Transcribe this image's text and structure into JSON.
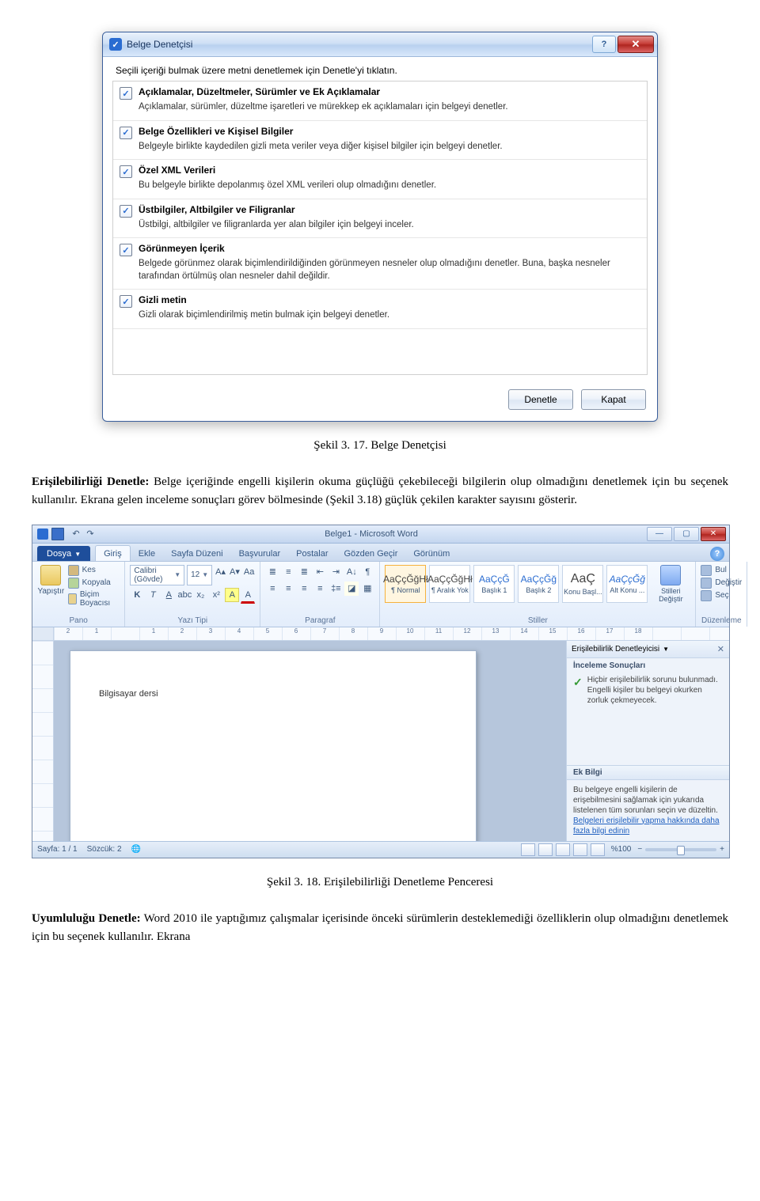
{
  "dialog": {
    "title": "Belge Denetçisi",
    "icon_name": "inspector-icon",
    "instruction": "Seçili içeriği bulmak üzere metni denetlemek için Denetle'yi tıklatın.",
    "items": [
      {
        "label": "Açıklamalar, Düzeltmeler, Sürümler ve Ek Açıklamalar",
        "desc": "Açıklamalar, sürümler, düzeltme işaretleri ve mürekkep ek açıklamaları için belgeyi denetler."
      },
      {
        "label": "Belge Özellikleri ve Kişisel Bilgiler",
        "desc": "Belgeyle birlikte kaydedilen gizli meta veriler veya diğer kişisel bilgiler için belgeyi denetler."
      },
      {
        "label": "Özel XML Verileri",
        "desc": "Bu belgeyle birlikte depolanmış özel XML verileri olup olmadığını denetler."
      },
      {
        "label": "Üstbilgiler, Altbilgiler ve Filigranlar",
        "desc": "Üstbilgi, altbilgiler ve filigranlarda yer alan bilgiler için belgeyi inceler."
      },
      {
        "label": "Görünmeyen İçerik",
        "desc": "Belgede görünmez olarak biçimlendirildiğinden görünmeyen nesneler olup olmadığını denetler. Buna, başka nesneler tarafından örtülmüş olan nesneler dahil değildir."
      },
      {
        "label": "Gizli metin",
        "desc": "Gizli olarak biçimlendirilmiş metin bulmak için belgeyi denetler."
      }
    ],
    "inspect_btn": "Denetle",
    "close_btn": "Kapat",
    "help_tooltip": "?",
    "close_glyph": "✕"
  },
  "captions": {
    "fig17": "Şekil 3. 17. Belge Denetçisi",
    "fig18": "Şekil 3. 18. Erişilebilirliği Denetleme Penceresi"
  },
  "paragraphs": {
    "p1_bold": "Erişilebilirliği Denetle:",
    "p1_rest": " Belge içeriğinde engelli kişilerin okuma güçlüğü çekebileceği bilgilerin olup olmadığını denetlemek için bu seçenek kullanılır. Ekrana gelen inceleme sonuçları görev bölmesinde (Şekil 3.18) güçlük çekilen karakter sayısını gösterir.",
    "p2_bold": "Uyumluluğu Denetle:",
    "p2_rest": " Word 2010 ile yaptığımız çalışmalar içerisinde önceki sürümlerin desteklemediği özelliklerin olup olmadığını denetlemek için bu seçenek kullanılır. Ekrana"
  },
  "word": {
    "title": "Belge1 - Microsoft Word",
    "qat": {
      "save": "save-icon",
      "undo": "undo-icon",
      "redo": "redo-icon"
    },
    "file_tab": "Dosya",
    "tabs": [
      "Giriş",
      "Ekle",
      "Sayfa Düzeni",
      "Başvurular",
      "Postalar",
      "Gözden Geçir",
      "Görünüm"
    ],
    "win_min": "—",
    "win_max": "▢",
    "win_close": "✕",
    "ribbon": {
      "clipboard": {
        "label": "Pano",
        "paste": "Yapıştır",
        "cut": "Kes",
        "copy": "Kopyala",
        "format_painter": "Biçim Boyacısı"
      },
      "font": {
        "label": "Yazı Tipi",
        "name": "Calibri (Gövde)",
        "size": "12"
      },
      "paragraph_label": "Paragraf",
      "styles": {
        "label": "Stiller",
        "change": "Stilleri Değiştir",
        "tiles": [
          {
            "sample": "AaÇçĞğHł",
            "name": "¶ Normal"
          },
          {
            "sample": "AaÇçĞğHł",
            "name": "¶ Aralık Yok"
          },
          {
            "sample": "AaÇçĞ",
            "name": "Başlık 1"
          },
          {
            "sample": "AaÇçĞğ",
            "name": "Başlık 2"
          },
          {
            "sample": "AaÇ",
            "name": "Konu Başl..."
          },
          {
            "sample": "AaÇçĞğ",
            "name": "Alt Konu ..."
          }
        ]
      },
      "editing": {
        "label": "Düzenleme",
        "find": "Bul",
        "replace": "Değiştir",
        "select": "Seç"
      }
    },
    "ruler_nums": [
      "2",
      "1",
      "",
      "1",
      "2",
      "3",
      "4",
      "5",
      "6",
      "7",
      "8",
      "9",
      "10",
      "11",
      "12",
      "13",
      "14",
      "15",
      "16",
      "17",
      "18"
    ],
    "document_text": "Bilgisayar dersi",
    "taskpane": {
      "title": "Erişilebilirlik Denetleyicisi",
      "section": "İnceleme Sonuçları",
      "result": "Hiçbir erişilebilirlik sorunu bulunmadı. Engelli kişiler bu belgeyi okurken zorluk çekmeyecek.",
      "info_header": "Ek Bilgi",
      "info_text": "Bu belgeye engelli kişilerin de erişebilmesini sağlamak için yukarıda listelenen tüm sorunları seçin ve düzeltin.",
      "info_link": "Belgeleri erişilebilir yapma hakkında daha fazla bilgi edinin"
    },
    "status": {
      "page": "Sayfa: 1 / 1",
      "words": "Sözcük: 2",
      "lang_icon": "lang-icon",
      "zoom_label": "%100",
      "zoom_minus": "−",
      "zoom_plus": "+"
    }
  }
}
